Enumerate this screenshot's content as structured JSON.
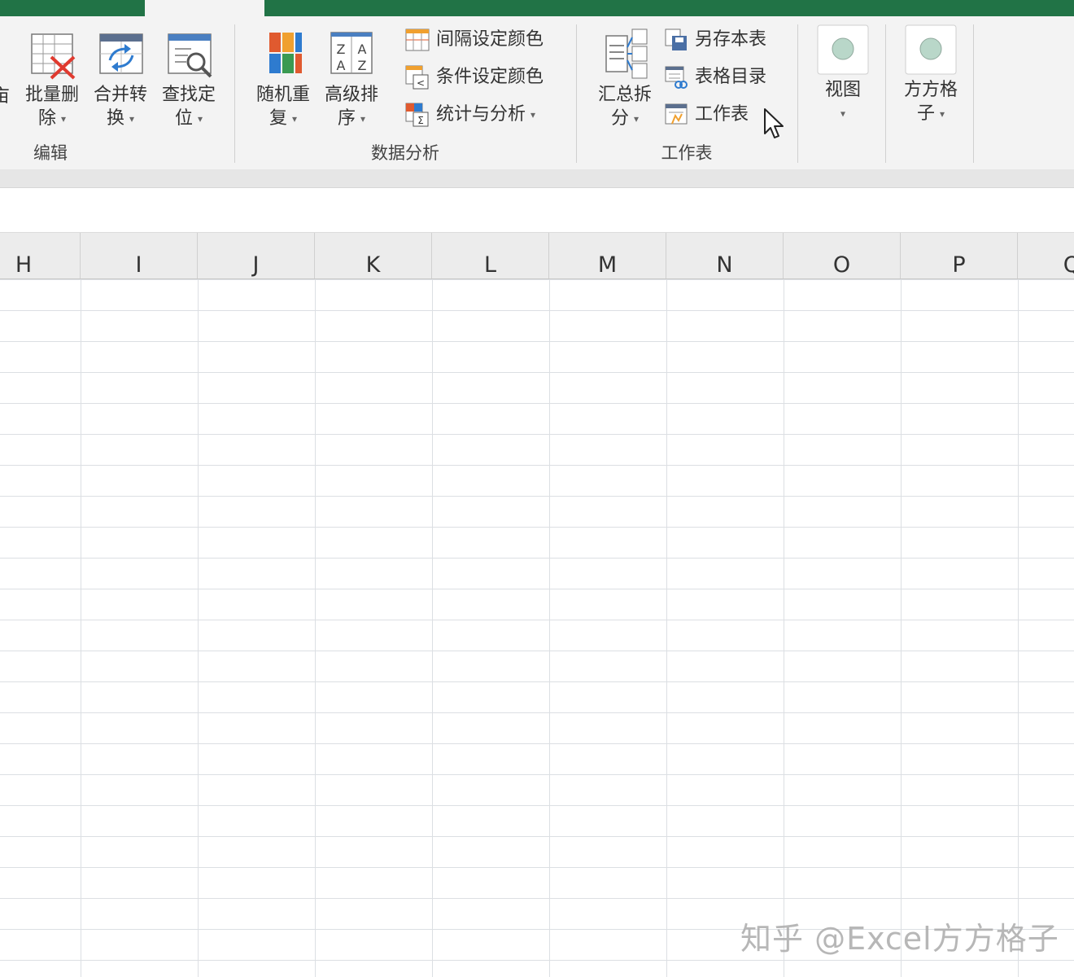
{
  "ribbon": {
    "edit_group": {
      "label": "编辑",
      "partial_label": "亩",
      "buttons": [
        {
          "line1": "批量删",
          "line2": "除",
          "icon": "batch-delete-icon"
        },
        {
          "line1": "合并转",
          "line2": "换",
          "icon": "merge-convert-icon"
        },
        {
          "line1": "查找定",
          "line2": "位",
          "icon": "find-locate-icon"
        }
      ]
    },
    "analysis_group": {
      "label": "数据分析",
      "buttons": [
        {
          "line1": "随机重",
          "line2": "复",
          "icon": "random-repeat-icon"
        },
        {
          "line1": "高级排",
          "line2": "序",
          "icon": "advanced-sort-icon"
        }
      ],
      "small_buttons": [
        {
          "label": "间隔设定颜色",
          "icon": "interval-color-icon"
        },
        {
          "label": "条件设定颜色",
          "icon": "condition-color-icon"
        },
        {
          "label": "统计与分析",
          "icon": "stats-analysis-icon"
        }
      ]
    },
    "worksheet_group": {
      "label": "工作表",
      "big_button": {
        "line1": "汇总拆",
        "line2": "分",
        "icon": "summary-split-icon"
      },
      "small_buttons": [
        {
          "label": "另存本表",
          "icon": "save-sheet-icon"
        },
        {
          "label": "表格目录",
          "icon": "table-directory-icon"
        },
        {
          "label": "工作表",
          "icon": "worksheet-icon"
        }
      ]
    },
    "view_button": {
      "label": "视图"
    },
    "ffgz_button": {
      "line1": "方方格",
      "line2": "子"
    }
  },
  "columns": [
    "H",
    "I",
    "J",
    "K",
    "L",
    "M",
    "N",
    "O",
    "P",
    "Q"
  ],
  "watermark": "知乎 @Excel方方格子",
  "colors": {
    "title_green": "#217346",
    "ribbon_bg": "#f3f3f3",
    "delete_red": "#e03a2f"
  }
}
